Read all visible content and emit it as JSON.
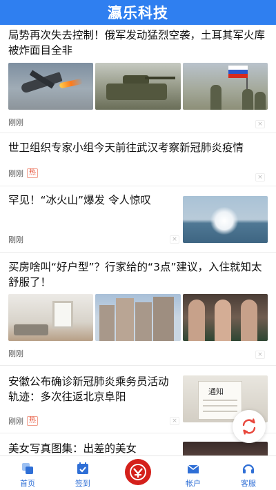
{
  "header": {
    "title": "瀛乐科技"
  },
  "colors": {
    "brand": "#2f7ff0",
    "hot": "#e8573f",
    "tab_icon": "#2f6fd6",
    "logo": "#d4201b"
  },
  "articles": [
    {
      "title": "局势再次失去控制！俄军发动猛烈空袭，土耳其军火库被炸面目全非",
      "time": "刚刚",
      "close": "×"
    },
    {
      "title": "世卫组织专家小组今天前往武汉考察新冠肺炎疫情",
      "time": "刚刚",
      "badge": "热",
      "close": "×"
    },
    {
      "title": "罕见！“冰火山”爆发 令人惊叹",
      "time": "刚刚",
      "close": "×"
    },
    {
      "title": "买房啥叫“好户型”？行家给的“3点”建议，入住就知太舒服了！",
      "time": "刚刚",
      "close": "×"
    },
    {
      "title": "安徽公布确诊新冠肺炎乘务员活动轨迹：多次往返北京阜阳",
      "time": "刚刚",
      "badge": "热",
      "close": "×",
      "image_text": "通知"
    },
    {
      "title": "美女写真图集：出差的美女"
    }
  ],
  "tabbar": {
    "items": [
      {
        "label": "首页",
        "icon": "home-icon"
      },
      {
        "label": "签到",
        "icon": "checkin-icon"
      },
      {
        "label": "",
        "icon": "bank-logo-icon"
      },
      {
        "label": "帐户",
        "icon": "account-icon"
      },
      {
        "label": "客服",
        "icon": "headset-icon"
      }
    ]
  }
}
